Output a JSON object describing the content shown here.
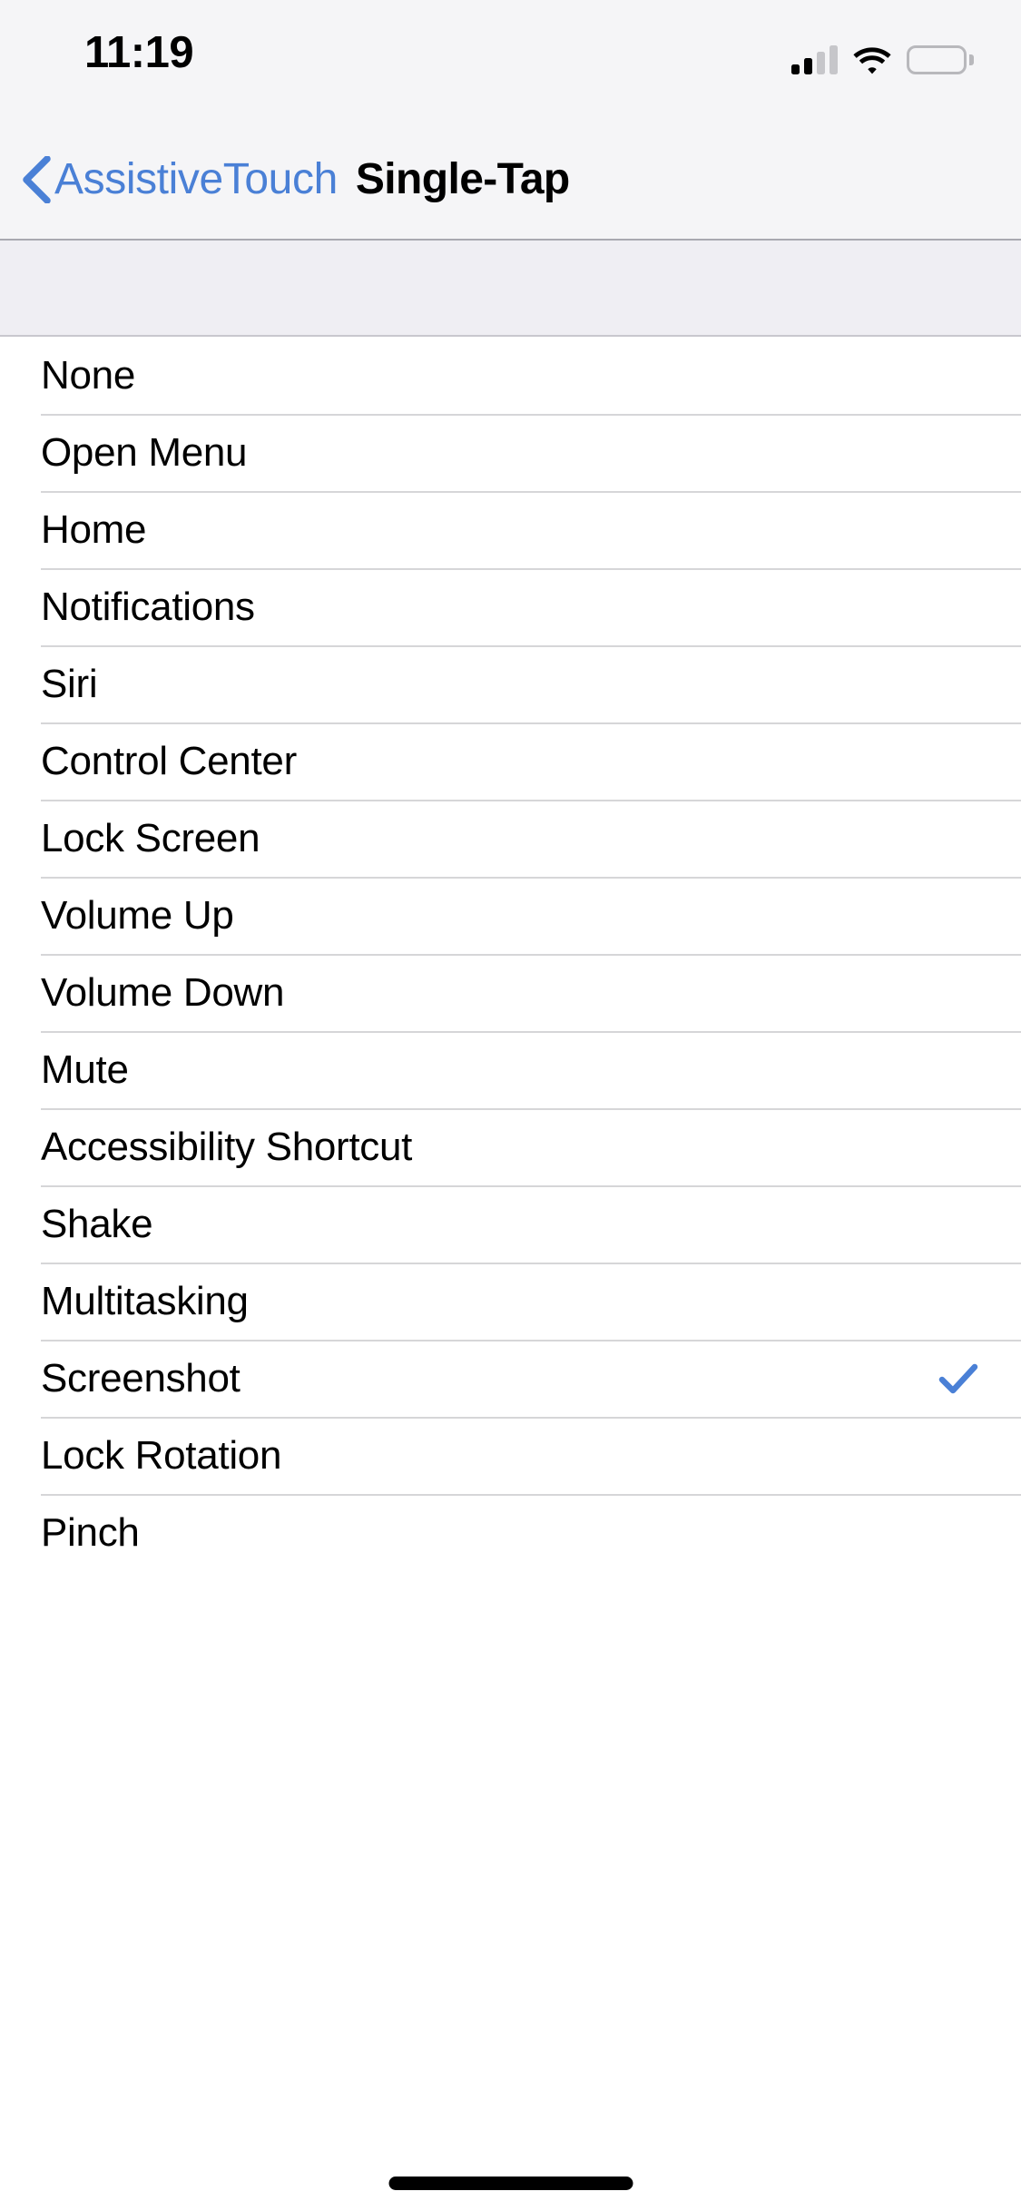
{
  "status_bar": {
    "time": "11:19",
    "cellular_icon": "cellular-signal-icon",
    "cellular_bars_filled": 2,
    "cellular_bars_total": 4,
    "wifi_icon": "wifi-icon",
    "battery_icon": "battery-icon",
    "battery_level_percent": 100
  },
  "nav_bar": {
    "back_icon": "chevron-left-icon",
    "back_label": "AssistiveTouch",
    "title": "Single-Tap",
    "accent_color": "#4A80D6",
    "background_color": "#F5F5F7"
  },
  "list": {
    "selected_index": 13,
    "checkmark_icon": "checkmark-icon",
    "checkmark_color": "#4A80D6",
    "items": [
      {
        "label": "None",
        "selected": false
      },
      {
        "label": "Open Menu",
        "selected": false
      },
      {
        "label": "Home",
        "selected": false
      },
      {
        "label": "Notifications",
        "selected": false
      },
      {
        "label": "Siri",
        "selected": false
      },
      {
        "label": "Control Center",
        "selected": false
      },
      {
        "label": "Lock Screen",
        "selected": false
      },
      {
        "label": "Volume Up",
        "selected": false
      },
      {
        "label": "Volume Down",
        "selected": false
      },
      {
        "label": "Mute",
        "selected": false
      },
      {
        "label": "Accessibility Shortcut",
        "selected": false
      },
      {
        "label": "Shake",
        "selected": false
      },
      {
        "label": "Multitasking",
        "selected": false
      },
      {
        "label": "Screenshot",
        "selected": true
      },
      {
        "label": "Lock Rotation",
        "selected": false
      },
      {
        "label": "Pinch",
        "selected": false
      }
    ]
  },
  "home_indicator": {
    "icon": "home-indicator-bar"
  }
}
